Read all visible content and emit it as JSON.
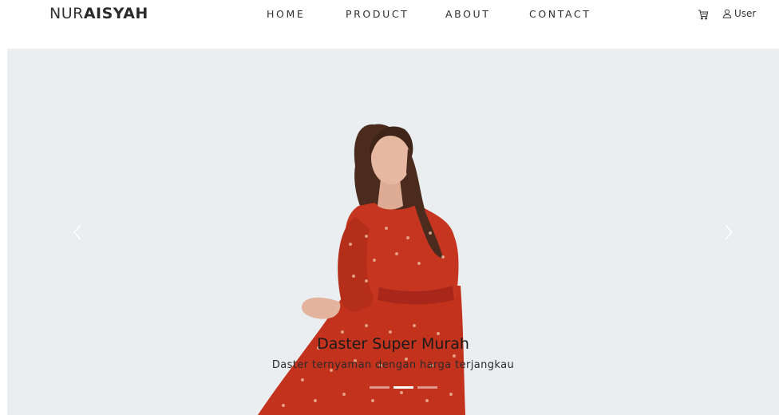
{
  "brand": {
    "light": "NUR",
    "bold": "AISYAH"
  },
  "nav": {
    "home": "HOME",
    "product": "PRODUCT",
    "about": "ABOUT",
    "contact": "CONTACT"
  },
  "header": {
    "cart_icon": "cart-icon",
    "user_icon": "user-icon",
    "user_label": "User"
  },
  "hero": {
    "title": "Daster Super Murah",
    "subtitle": "Daster ternyaman dengan harga terjangkau",
    "slides": 3,
    "active_slide": 2,
    "background": "#ebeef0",
    "dress_color": "#c2321d"
  }
}
